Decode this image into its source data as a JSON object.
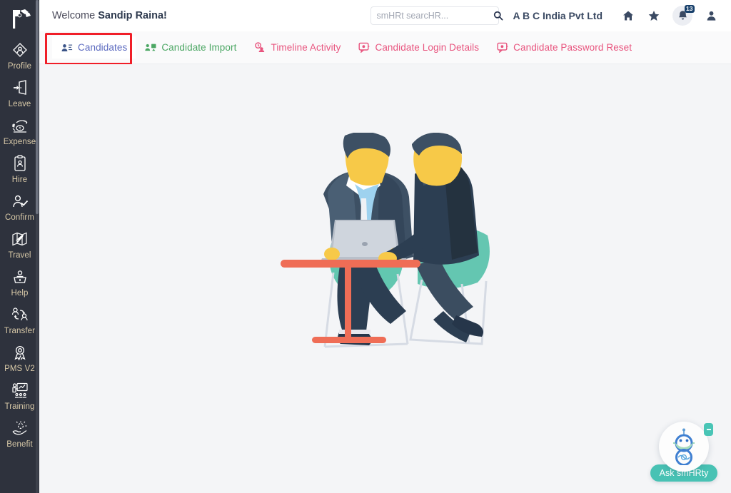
{
  "sidebar": {
    "logo_icon": "flag-handshake-logo-icon",
    "items": [
      {
        "label": "Profile",
        "icon": "profile-diamond-icon"
      },
      {
        "label": "Leave",
        "icon": "door-exit-icon"
      },
      {
        "label": "Expense",
        "icon": "hand-rupee-icon"
      },
      {
        "label": "Hire",
        "icon": "clipboard-person-icon"
      },
      {
        "label": "Confirm",
        "icon": "person-check-icon"
      },
      {
        "label": "Travel",
        "icon": "map-plane-icon"
      },
      {
        "label": "Help",
        "icon": "help-desk-icon"
      },
      {
        "label": "Transfer",
        "icon": "people-arrows-icon"
      },
      {
        "label": "PMS V2",
        "icon": "award-ribbon-icon"
      },
      {
        "label": "Training",
        "icon": "presentation-board-icon"
      },
      {
        "label": "Benefit",
        "icon": "hand-gift-icon"
      }
    ]
  },
  "header": {
    "welcome_prefix": "Welcome ",
    "user_name": "Sandip Raina!",
    "company": "A B C India Pvt Ltd",
    "search": {
      "placeholder": "smHRt searcHR...",
      "value": "",
      "icon": "search-icon"
    },
    "icons": [
      {
        "name": "home-icon"
      },
      {
        "name": "star-icon"
      },
      {
        "name": "bell-icon",
        "badge": "13"
      },
      {
        "name": "user-icon"
      }
    ]
  },
  "tabs": [
    {
      "label": "Candidates",
      "icon": "candidates-icon",
      "active": true
    },
    {
      "label": "Candidate Import",
      "icon": "import-users-icon",
      "active": false
    },
    {
      "label": "Timeline Activity",
      "icon": "timeline-clock-icon",
      "active": false
    },
    {
      "label": "Candidate Login Details",
      "icon": "login-chat-icon",
      "active": false
    },
    {
      "label": "Candidate Password Reset",
      "icon": "password-chat-icon",
      "active": false
    }
  ],
  "content": {
    "illustration": "two-businessmen-at-table-with-laptop-illustration"
  },
  "chatbot": {
    "label": "Ask smHRty",
    "icon": "robot-with-mask-icon",
    "chip_icon": "minimize-chip-icon"
  },
  "colors": {
    "sidebar_bg": "#2e323d",
    "sidebar_label": "#d8c9a8",
    "page_bg": "#f4f5f7",
    "highlight": "#f01e28",
    "accent_active_tab": "#5c6bc0",
    "accent_green": "#4ca764",
    "accent_pink": "#e8547e",
    "chatbot_teal": "#48c2b4",
    "badge_navy": "#17406b"
  }
}
